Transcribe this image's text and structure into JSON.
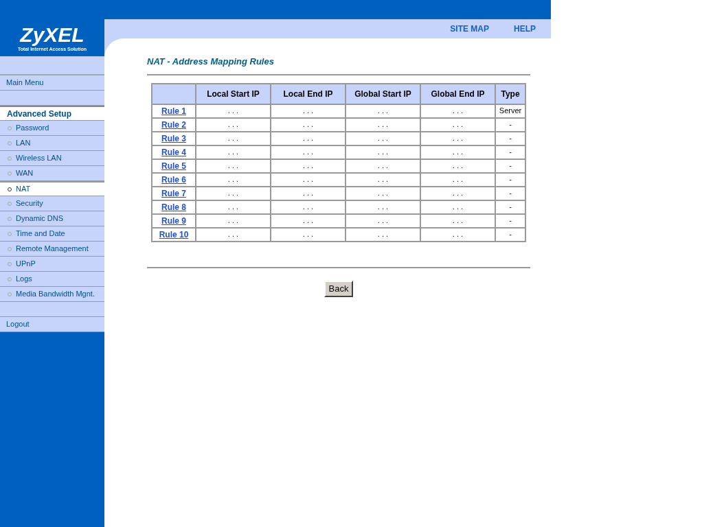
{
  "logo": {
    "name": "ZyXEL",
    "tagline": "Total Internet Access Solution"
  },
  "header_links": [
    "SITE MAP",
    "HELP"
  ],
  "sidebar": {
    "main_menu": "Main Menu",
    "section": "Advanced Setup",
    "items": [
      {
        "label": "Password",
        "selected": false
      },
      {
        "label": "LAN",
        "selected": false
      },
      {
        "label": "Wireless LAN",
        "selected": false
      },
      {
        "label": "WAN",
        "selected": false
      },
      {
        "label": "NAT",
        "selected": true
      },
      {
        "label": "Security",
        "selected": false
      },
      {
        "label": "Dynamic DNS",
        "selected": false
      },
      {
        "label": "Time and Date",
        "selected": false
      },
      {
        "label": "Remote Management",
        "selected": false
      },
      {
        "label": "UPnP",
        "selected": false
      },
      {
        "label": "Logs",
        "selected": false
      },
      {
        "label": "Media Bandwidth Mgnt.",
        "selected": false
      }
    ],
    "logout": "Logout"
  },
  "page_title": "NAT - Address Mapping Rules",
  "table": {
    "columns": [
      "Local Start IP",
      "Local End IP",
      "Global Start IP",
      "Global End IP",
      "Type"
    ],
    "rows": [
      {
        "rule": "Rule 1",
        "cells": [
          ". . .",
          ". . .",
          ". . .",
          ". . .",
          "Server"
        ]
      },
      {
        "rule": "Rule 2",
        "cells": [
          ". . .",
          ". . .",
          ". . .",
          ". . .",
          "-"
        ]
      },
      {
        "rule": "Rule 3",
        "cells": [
          ". . .",
          ". . .",
          ". . .",
          ". . .",
          "-"
        ]
      },
      {
        "rule": "Rule 4",
        "cells": [
          ". . .",
          ". . .",
          ". . .",
          ". . .",
          "-"
        ]
      },
      {
        "rule": "Rule 5",
        "cells": [
          ". . .",
          ". . .",
          ". . .",
          ". . .",
          "-"
        ]
      },
      {
        "rule": "Rule 6",
        "cells": [
          ". . .",
          ". . .",
          ". . .",
          ". . .",
          "-"
        ]
      },
      {
        "rule": "Rule 7",
        "cells": [
          ". . .",
          ". . .",
          ". . .",
          ". . .",
          "-"
        ]
      },
      {
        "rule": "Rule 8",
        "cells": [
          ". . .",
          ". . .",
          ". . .",
          ". . .",
          "-"
        ]
      },
      {
        "rule": "Rule 9",
        "cells": [
          ". . .",
          ". . .",
          ". . .",
          ". . .",
          "-"
        ]
      },
      {
        "rule": "Rule 10",
        "cells": [
          ". . .",
          ". . .",
          ". . .",
          ". . .",
          "-"
        ]
      }
    ]
  },
  "back_button": "Back"
}
